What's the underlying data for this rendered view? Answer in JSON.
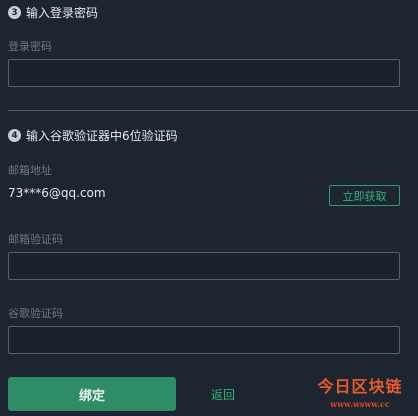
{
  "step3": {
    "number": "3",
    "title": "输入登录密码"
  },
  "login_password": {
    "label": "登录密码",
    "value": "",
    "placeholder": ""
  },
  "step4": {
    "number": "4",
    "title": "输入谷歌验证器中6位验证码"
  },
  "email": {
    "label": "邮箱地址",
    "value": "73***6@qq.com",
    "get_code_label": "立即获取"
  },
  "email_code": {
    "label": "邮箱验证码",
    "value": "",
    "placeholder": ""
  },
  "google_code": {
    "label": "谷歌验证码",
    "value": "",
    "placeholder": ""
  },
  "actions": {
    "bind_label": "绑定",
    "back_label": "返回"
  },
  "watermark": {
    "title": "今日区块链",
    "url": "www.wsww.cc"
  },
  "colors": {
    "background": "#1d2630",
    "accent": "#2e8c66",
    "link": "#34b37d"
  }
}
